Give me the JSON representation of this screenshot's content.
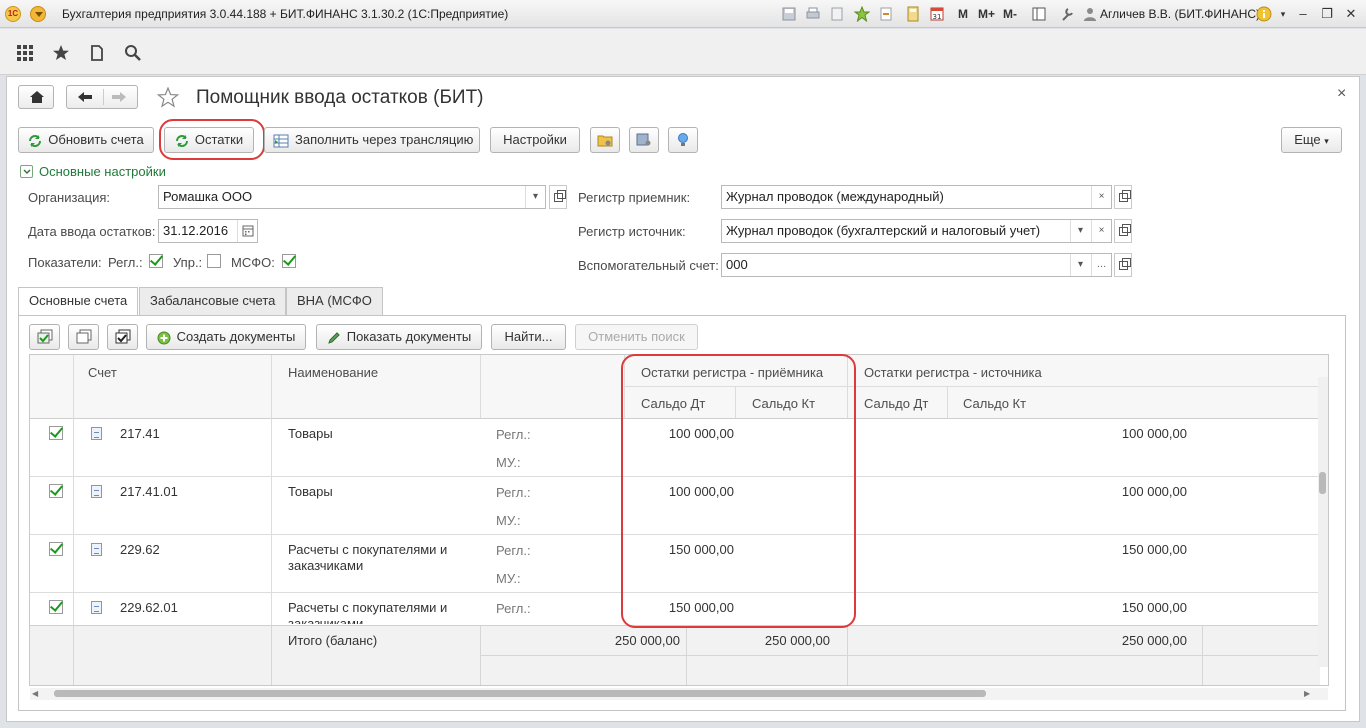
{
  "window": {
    "title": "Бухгалтерия предприятия 3.0.44.188 + БИТ.ФИНАНС 3.1.30.2  (1С:Предприятие)",
    "user": "Агличев В.В. (БИТ.ФИНАНС)",
    "m_labels": [
      "M",
      "M+",
      "M-"
    ]
  },
  "form": {
    "title": "Помощник ввода остатков (БИТ)",
    "close": "×"
  },
  "toolbar": {
    "refresh_accounts": "Обновить счета",
    "balances": "Остатки",
    "fill_translation": "Заполнить через трансляцию",
    "settings": "Настройки",
    "more": "Еще"
  },
  "main_settings": {
    "group_label": "Основные настройки",
    "organization_label": "Организация:",
    "organization_value": "Ромашка ООО",
    "date_label": "Дата ввода остатков:",
    "date_value": "31.12.2016",
    "indicators_label": "Показатели:",
    "regl_label": "Регл.:",
    "upr_label": "Упр.:",
    "msfo_label": "МСФО:",
    "regl_checked": true,
    "upr_checked": false,
    "msfo_checked": true,
    "receiver_label": "Регистр приемник:",
    "receiver_value": "Журнал проводок (международный)",
    "source_label": "Регистр источник:",
    "source_value": "Журнал проводок (бухгалтерский и налоговый учет)",
    "aux_label": "Вспомогательный счет:",
    "aux_value": "000"
  },
  "tabs": [
    "Основные счета",
    "Забалансовые счета",
    "ВНА (МСФО"
  ],
  "grid_toolbar": {
    "create_docs": "Создать документы",
    "show_docs": "Показать документы",
    "find": "Найти...",
    "cancel_search": "Отменить поиск"
  },
  "grid": {
    "col_account": "Счет",
    "col_name": "Наименование",
    "group_receiver": "Остатки регистра - приёмника",
    "group_source": "Остатки регистра - источника",
    "saldo_dt": "Сальдо Дт",
    "saldo_kt": "Сальдо Кт",
    "rows": [
      {
        "checked": true,
        "account": "217.41",
        "name_line1": "Товары",
        "name_line2": "",
        "regl": "Регл.:",
        "mu": "МУ.:",
        "recv_dt": "100 000,00",
        "src_value": "100 000,00"
      },
      {
        "checked": true,
        "account": "217.41.01",
        "name_line1": "Товары",
        "name_line2": "",
        "regl": "Регл.:",
        "mu": "МУ.:",
        "recv_dt": "100 000,00",
        "src_value": "100 000,00"
      },
      {
        "checked": true,
        "account": "229.62",
        "name_line1": "Расчеты с покупателями и",
        "name_line2": "заказчиками",
        "regl": "Регл.:",
        "mu": "МУ.:",
        "recv_dt": "150 000,00",
        "src_value": "150 000,00"
      },
      {
        "checked": true,
        "account": "229.62.01",
        "name_line1": "Расчеты с покупателями и",
        "name_line2": "заказчиками",
        "regl": "Регл.:",
        "mu": "",
        "recv_dt": "150 000,00",
        "src_value": "150 000,00"
      }
    ],
    "footer": {
      "label": "Итого (баланс)",
      "recv_dt": "250 000,00",
      "recv_kt": "250 000,00",
      "src_value": "250 000,00"
    }
  },
  "colors": {
    "highlight": "#dd3b3b",
    "check": "#1a9a1a",
    "link_green": "#1f7a3a"
  }
}
